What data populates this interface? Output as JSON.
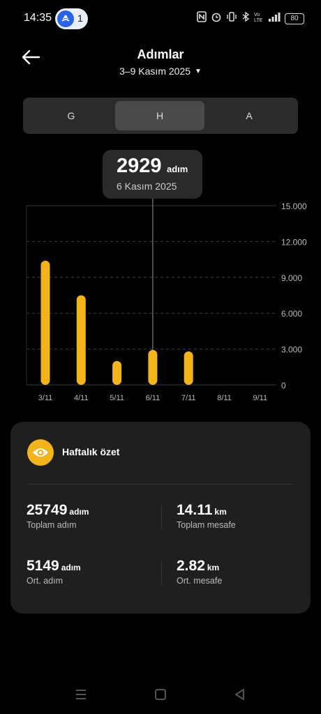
{
  "status_bar": {
    "time": "14:35",
    "hotspot_count": "1",
    "battery": "80",
    "icons": [
      "hotspot-icon",
      "nfc-icon",
      "alarm-icon",
      "vibrate-icon",
      "bluetooth-icon",
      "volte-icon",
      "signal-icon"
    ]
  },
  "header": {
    "title": "Adımlar",
    "date_range": "3–9 Kasım 2025"
  },
  "tabs": [
    {
      "label": "G"
    },
    {
      "label": "H",
      "selected": true
    },
    {
      "label": "A"
    }
  ],
  "tooltip": {
    "value": "2929",
    "unit": "adım",
    "date": "6 Kasım 2025"
  },
  "colors": {
    "accent": "#f2b31b",
    "background": "#000000",
    "card": "#1f1f1f"
  },
  "chart_data": {
    "type": "bar",
    "categories": [
      "3/11",
      "4/11",
      "5/11",
      "6/11",
      "7/11",
      "8/11",
      "9/11"
    ],
    "values": [
      10400,
      7500,
      2000,
      2929,
      2800,
      0,
      0
    ],
    "y_ticks": [
      "0",
      "3.000",
      "6.000",
      "9.000",
      "12.000",
      "15.000"
    ],
    "ylim": [
      0,
      15000
    ],
    "grid": true,
    "selected_index": 3
  },
  "summary": {
    "title": "Haftalık özet",
    "stats": [
      {
        "value": "25749",
        "unit": "adım",
        "label": "Toplam adım"
      },
      {
        "value": "14.11",
        "unit": "km",
        "label": "Toplam mesafe"
      },
      {
        "value": "5149",
        "unit": "adım",
        "label": "Ort. adım"
      },
      {
        "value": "2.82",
        "unit": "km",
        "label": "Ort. mesafe"
      }
    ]
  },
  "navbar": {
    "icons": [
      "recent-apps-icon",
      "home-icon",
      "back-nav-icon"
    ]
  }
}
